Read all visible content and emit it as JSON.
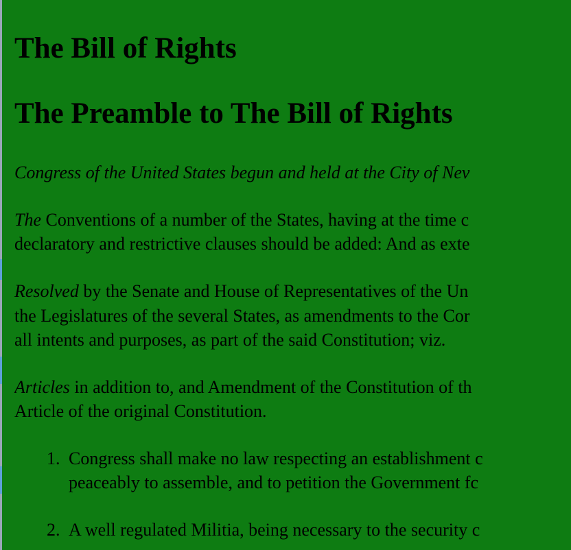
{
  "document": {
    "title": "The Bill of Rights",
    "subtitle": "The Preamble to The Bill of Rights",
    "intro_line": "Congress of the United States begun and held at the City of Nev",
    "para1": {
      "lead": "The",
      "line1_rest": " Conventions of a number of the States, having at the time c",
      "line2": "declaratory and restrictive clauses should be added: And as exte"
    },
    "para2": {
      "lead": "Resolved",
      "line1_rest": " by the Senate and House of Representatives of the Un",
      "line2": "the Legislatures of the several States, as amendments to the Cor",
      "line3": "all intents and purposes, as part of the said Constitution; viz."
    },
    "para3": {
      "lead": "Articles",
      "line1_rest": " in addition to, and Amendment of the Constitution of th",
      "line2": "Article of the original Constitution."
    },
    "articles": [
      {
        "number": "1.",
        "line1": "Congress shall make no law respecting an establishment c",
        "line2": "peaceably to assemble, and to petition the Government fc"
      },
      {
        "number": "2.",
        "line1": "A well regulated Militia, being necessary to the security c"
      }
    ]
  }
}
